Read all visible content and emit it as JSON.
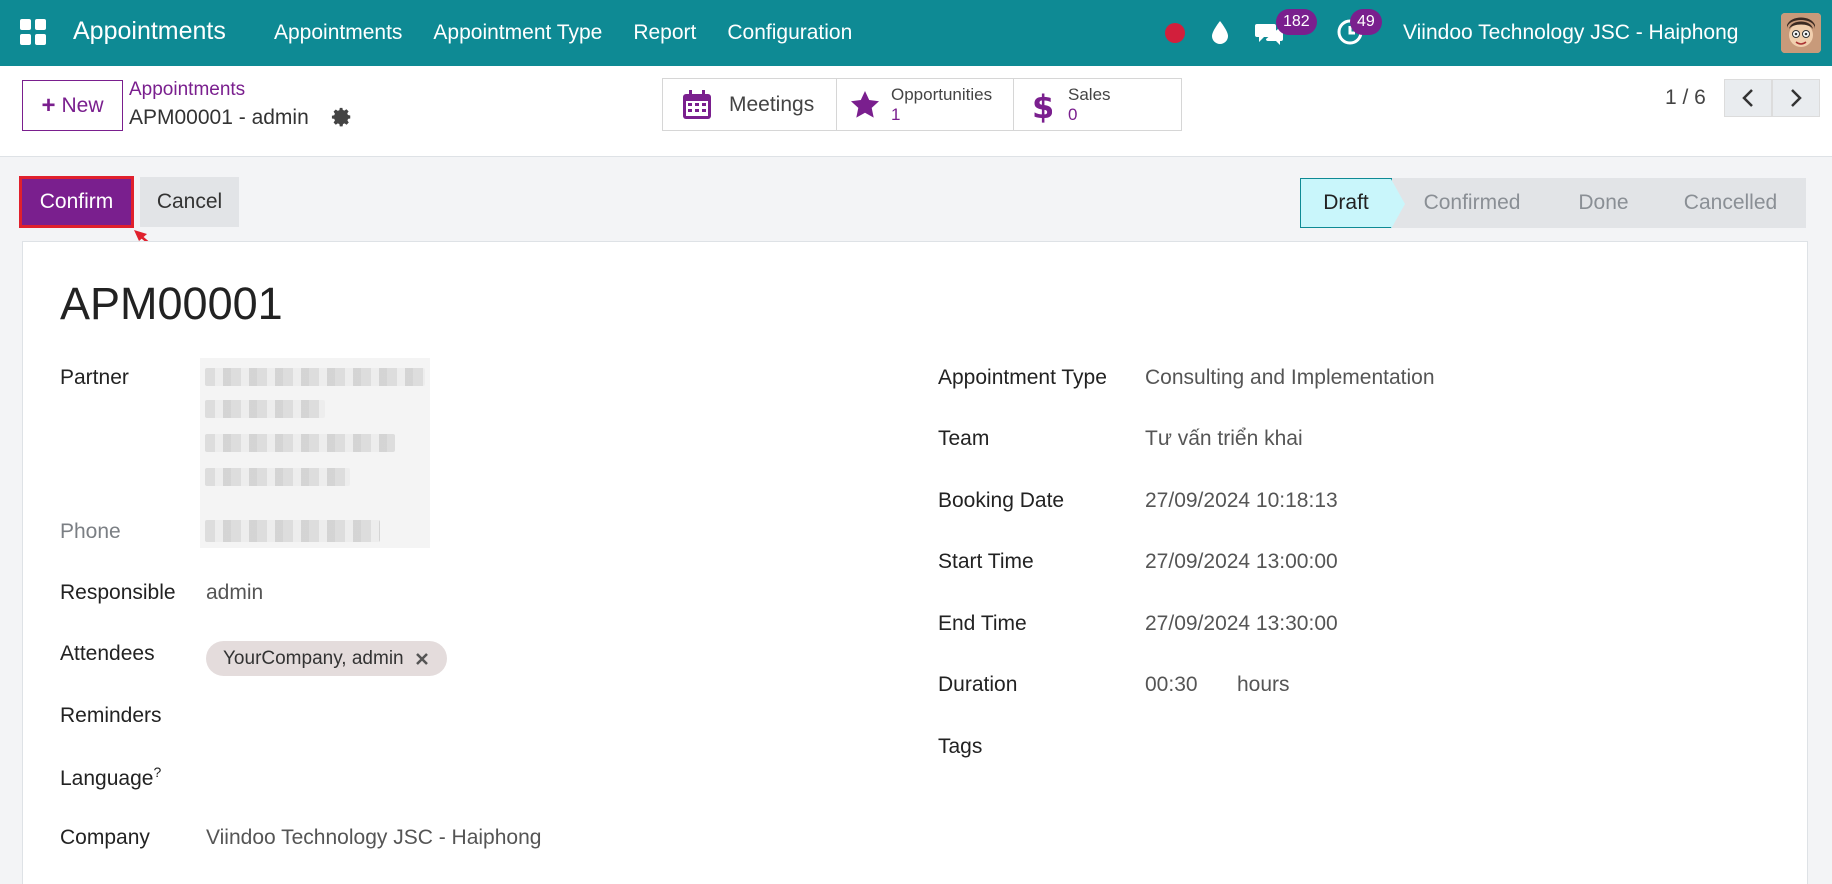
{
  "navbar": {
    "app_name": "Appointments",
    "menu": [
      "Appointments",
      "Appointment Type",
      "Report",
      "Configuration"
    ],
    "messages_count": "182",
    "activities_count": "49",
    "company": "Viindoo Technology JSC - Haiphong"
  },
  "control": {
    "new_label": "New",
    "breadcrumb_parent": "Appointments",
    "breadcrumb_current": "APM00001 - admin",
    "smart": {
      "meetings_label": "Meetings",
      "opportunities_label": "Opportunities",
      "opportunities_value": "1",
      "sales_label": "Sales",
      "sales_value": "0"
    },
    "pager": "1 / 6"
  },
  "actions": {
    "confirm_label": "Confirm",
    "cancel_label": "Cancel"
  },
  "stages": [
    "Draft",
    "Confirmed",
    "Done",
    "Cancelled"
  ],
  "form": {
    "title": "APM00001",
    "left": {
      "partner_label": "Partner",
      "phone_label": "Phone",
      "responsible_label": "Responsible",
      "responsible_value": "admin",
      "attendees_label": "Attendees",
      "attendee_tag": "YourCompany, admin",
      "reminders_label": "Reminders",
      "language_label": "Language",
      "language_help": "?",
      "company_label": "Company",
      "company_value": "Viindoo Technology JSC - Haiphong"
    },
    "right": {
      "appointment_type_label": "Appointment Type",
      "appointment_type_value": "Consulting and Implementation",
      "team_label": "Team",
      "team_value": "Tư vấn triển khai",
      "booking_date_label": "Booking Date",
      "booking_date_value": "27/09/2024 10:18:13",
      "start_time_label": "Start Time",
      "start_time_value": "27/09/2024 13:00:00",
      "end_time_label": "End Time",
      "end_time_value": "27/09/2024 13:30:00",
      "duration_label": "Duration",
      "duration_value": "00:30",
      "duration_unit": "hours",
      "tags_label": "Tags"
    }
  },
  "colors": {
    "navbar": "#0e8a94",
    "primary": "#7a1f8e",
    "stage_active": "#c9f6fb",
    "highlight_border": "#e0202d"
  }
}
